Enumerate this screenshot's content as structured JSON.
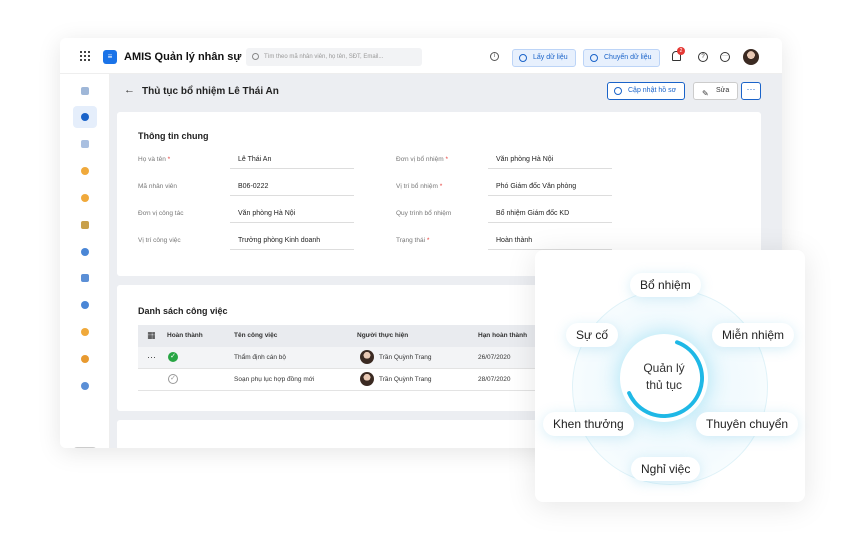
{
  "app": {
    "title": "AMIS Quản lý nhân sự",
    "logo_color": "#1a73e8"
  },
  "search": {
    "placeholder": "Tìm theo mã nhân viên, họ tên, SĐT, Email..."
  },
  "topbar": {
    "btn_fetch": "Lấy dữ liệu",
    "btn_transfer": "Chuyển dữ liệu",
    "notification_count": "2"
  },
  "page": {
    "title": "Thủ tục bổ nhiệm Lê Thái An",
    "btn_update": "Cập nhật hồ sơ",
    "btn_edit": "Sửa",
    "btn_more": "···"
  },
  "general": {
    "title": "Thông tin chung",
    "fields": [
      {
        "label": "Họ và tên",
        "required": "*",
        "value": "Lê Thái An"
      },
      {
        "label": "Mã nhân viên",
        "required": "",
        "value": "B06-0222"
      },
      {
        "label": "Đơn vị công tác",
        "required": "",
        "value": "Văn phòng Hà Nội"
      },
      {
        "label": "Vị trí công việc",
        "required": "",
        "value": "Trưởng phòng Kinh doanh"
      },
      {
        "label": "Đơn vị bổ nhiệm",
        "required": "*",
        "value": "Văn phòng Hà Nội"
      },
      {
        "label": "Vị trí bổ nhiệm",
        "required": "*",
        "value": "Phó Giám đốc Văn phòng"
      },
      {
        "label": "Quy trình bổ nhiệm",
        "required": "",
        "value": "Bổ nhiệm Giám đốc KD"
      },
      {
        "label": "Trạng thái",
        "required": "*",
        "value": "Hoàn thành"
      }
    ]
  },
  "tasks": {
    "title": "Danh sách công việc",
    "columns": [
      "Hoàn thành",
      "Tên công việc",
      "Người thực hiện",
      "Hạn hoàn thành"
    ],
    "rows": [
      {
        "name": "Thẩm định cán bộ",
        "assignee": "Trần Quỳnh Trang",
        "due": "26/07/2020",
        "done": true
      },
      {
        "name": "Soạn phụ lục hợp đồng mới",
        "assignee": "Trần Quỳnh Trang",
        "due": "28/07/2020",
        "done": false
      }
    ]
  },
  "diagram": {
    "center": [
      "Quản lý",
      "thủ tục"
    ],
    "items": [
      "Bổ nhiệm",
      "Miễn nhiệm",
      "Thuyên chuyển",
      "Nghỉ việc",
      "Khen thưởng",
      "Sự cố"
    ],
    "ring_color": "#1fb8e6"
  }
}
